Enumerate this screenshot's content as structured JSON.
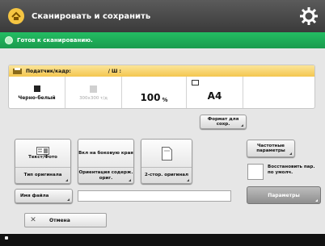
{
  "header": {
    "title": "Сканировать и сохранить",
    "app_icon": "scan-save-icon",
    "settings_icon": "gear-icon"
  },
  "status": {
    "text": "Готов к сканированию."
  },
  "settings_panel": {
    "source_label": "Податчик/кадр:",
    "pages_label": "/ Ш :",
    "color_mode": "Черно-белый",
    "resolution": "300x300 т/д",
    "zoom_value": "100",
    "zoom_unit": "%",
    "paper_size": "A4"
  },
  "buttons": {
    "file_format": "Формат для сохр.",
    "text_photo_top": "Текст/Фото",
    "original_type": "Тип оригинала",
    "bind_top": "Вкл на боковую края",
    "original_orientation": "Ориентация содерж. ориг.",
    "duplex_original": "2-стор. оригинал",
    "frequent_settings": "Частотные параметры",
    "restore_settings": "Восстановить пар. по умолч.",
    "file_name": "Имя файла",
    "options": "Параметры",
    "cancel": "Отмена"
  },
  "inputs": {
    "file_name_value": ""
  },
  "colors": {
    "header": "#4a4a4a",
    "status": "#1fae57",
    "settings_head": "#f4c64f",
    "background": "#e6e6e6"
  }
}
